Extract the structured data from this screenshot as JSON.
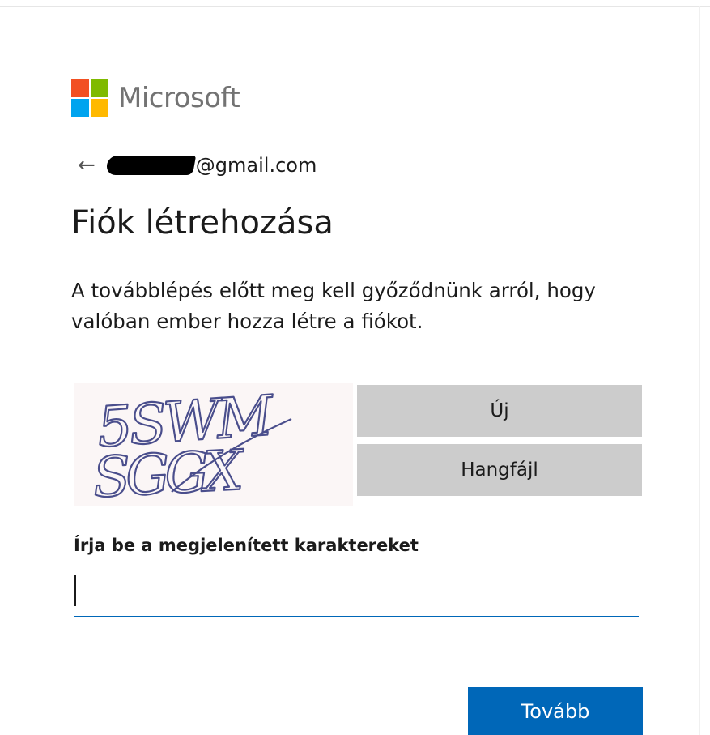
{
  "brand": {
    "name": "Microsoft",
    "logo_colors": [
      "#f25022",
      "#7fba00",
      "#00a4ef",
      "#ffb900"
    ]
  },
  "identity": {
    "back_icon": "arrow-left-icon",
    "email_visible": "@gmail.com"
  },
  "title": "Fiók létrehozása",
  "description": "A továbblépés előtt meg kell győződnünk arról, hogy valóban ember hozza létre a fiókot.",
  "captcha": {
    "line1": "5SWM",
    "line2": "SGGX",
    "new_button": "Új",
    "audio_button": "Hangfájl"
  },
  "input": {
    "label": "Írja be a megjelenített karaktereket",
    "value": ""
  },
  "next_button": "Tovább",
  "colors": {
    "accent": "#0067b8",
    "button_gray": "#cccccc",
    "captcha_ink": "#4a4e8c"
  }
}
